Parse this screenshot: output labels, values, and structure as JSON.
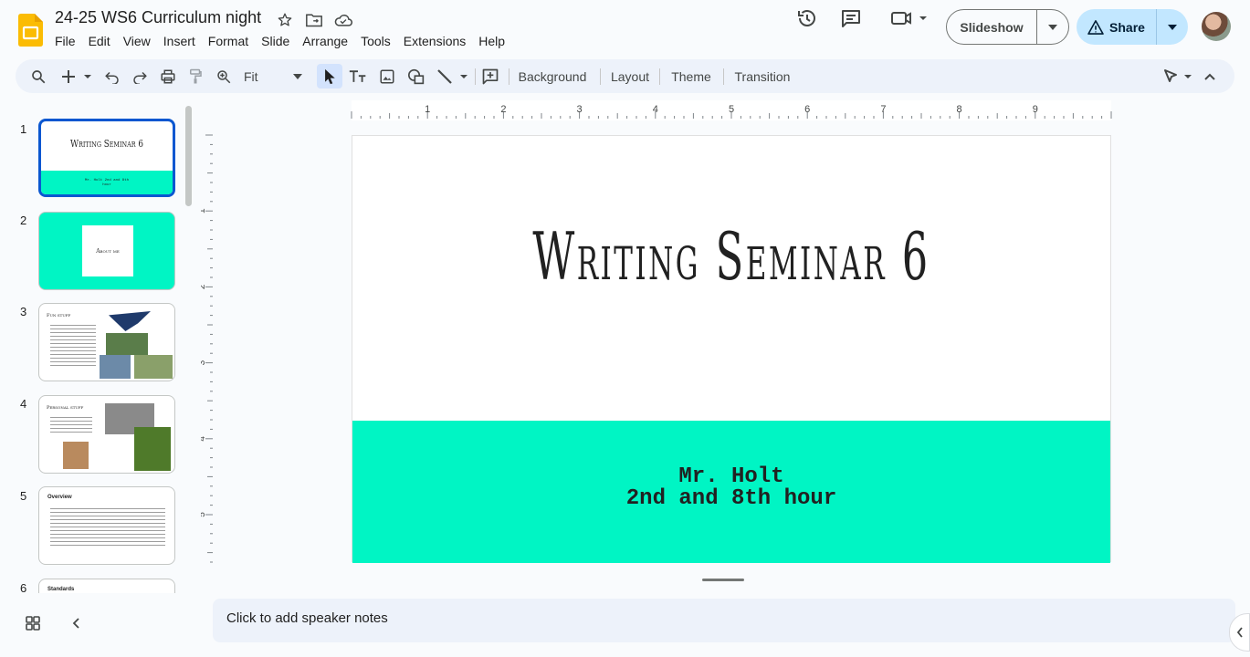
{
  "app": {
    "doc_title": "24-25 WS6 Curriculum night"
  },
  "menu": [
    "File",
    "Edit",
    "View",
    "Insert",
    "Format",
    "Slide",
    "Arrange",
    "Tools",
    "Extensions",
    "Help"
  ],
  "header_actions": {
    "slideshow_label": "Slideshow",
    "share_label": "Share"
  },
  "toolbar": {
    "zoom_value": "Fit",
    "background_label": "Background",
    "layout_label": "Layout",
    "theme_label": "Theme",
    "transition_label": "Transition"
  },
  "ruler": {
    "h_labels": [
      "1",
      "2",
      "3",
      "4",
      "5",
      "6",
      "7",
      "8",
      "9"
    ],
    "v_labels": [
      "1",
      "2",
      "3",
      "4",
      "5"
    ]
  },
  "slides": [
    {
      "number": "1",
      "title": "Writing Seminar 6",
      "sub": "Mr. Holt 2nd and 8th hour"
    },
    {
      "number": "2",
      "title": "About me"
    },
    {
      "number": "3",
      "title": "Fun stuff"
    },
    {
      "number": "4",
      "title": "Personal stuff"
    },
    {
      "number": "5",
      "title": "Overview"
    },
    {
      "number": "6",
      "title": "Standards"
    }
  ],
  "current_slide": {
    "title": "Writing Seminar 6",
    "subtitle_line1": "Mr. Holt",
    "subtitle_line2": "2nd and 8th hour"
  },
  "speaker_notes": {
    "placeholder": "Click to add speaker notes"
  },
  "colors": {
    "accent_teal": "#00f5c4",
    "share_bg": "#c2e7ff",
    "selection_blue": "#0b57d0",
    "slides_logo_yellow": "#fbbc04"
  }
}
